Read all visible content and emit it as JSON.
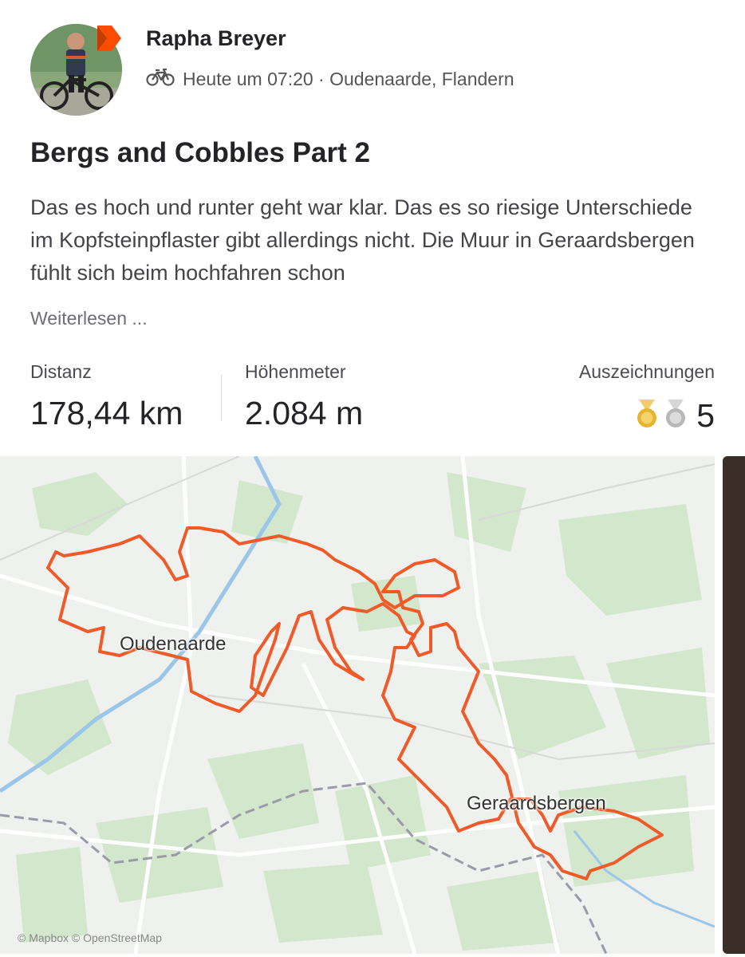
{
  "header": {
    "athlete_name": "Rapha Breyer",
    "activity_meta": "Heute um 07:20 · Oudenaarde, Flandern",
    "activity_icon": "bike-icon"
  },
  "activity": {
    "title": "Bergs and Cobbles Part 2",
    "description": "Das es hoch und runter geht war klar. Das es so riesige Unterschiede im Kopfsteinpflaster gibt allerdings nicht. Die Muur in Geraardsbergen fühlt sich beim hochfahren schon",
    "read_more": "Weiterlesen ..."
  },
  "stats": {
    "distance_label": "Distanz",
    "distance_value": "178,44 km",
    "elevation_label": "Höhenmeter",
    "elevation_value": "2.084 m",
    "awards_label": "Auszeichnungen",
    "awards_count": "5"
  },
  "map": {
    "label_oudenaarde": "Oudenaarde",
    "label_geraardsbergen": "Geraardsbergen",
    "attribution": "© Mapbox © OpenStreetMap",
    "route_color": "#f05a28"
  },
  "colors": {
    "accent": "#fc4c02",
    "gold": "#e6b530",
    "silver": "#b8b8b8"
  }
}
